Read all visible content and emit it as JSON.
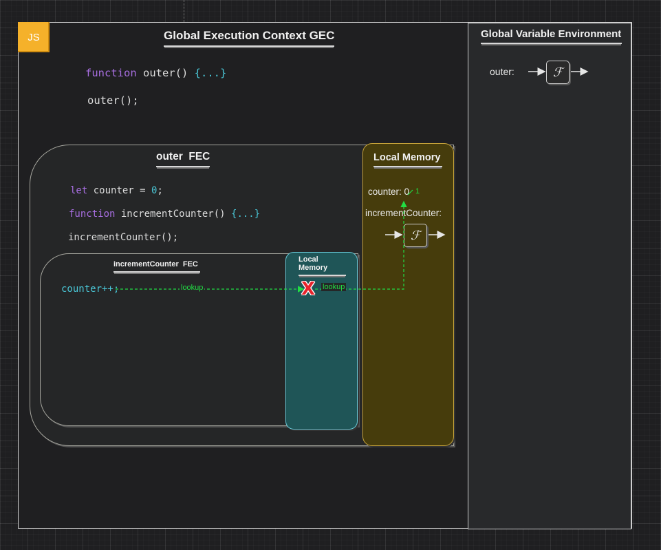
{
  "badge": "JS",
  "gec": {
    "title": "Global Execution Context GEC",
    "code_keyword": "function",
    "code_name": "outer()",
    "code_body": "{...}",
    "call": "outer();"
  },
  "gve": {
    "title": "Global Variable Environment",
    "outer_label": "outer:",
    "fn_glyph": "ℱ"
  },
  "outer_fec": {
    "title": "outer  FEC",
    "line1_kw": "let",
    "line1_rest": " counter = ",
    "line1_num": "0",
    "line1_end": ";",
    "line2_kw": "function",
    "line2_rest": " incrementCounter() ",
    "line2_body": "{...}",
    "line3": "incrementCounter();"
  },
  "outer_memory": {
    "title": "Local Memory",
    "counter_label": "counter: 0",
    "counter_new": "1",
    "inc_label": "incrementCounter:",
    "fn_glyph": "ℱ"
  },
  "inc_fec": {
    "title": "incrementCounter  FEC",
    "code": "counter++;"
  },
  "inc_memory": {
    "title": "Local Memory"
  },
  "lookup": {
    "label1": "lookup",
    "label2": "lookup",
    "miss": "X"
  },
  "colors": {
    "badge": "#f5b12a",
    "outer_memory_bg": "#463c0c",
    "outer_memory_border": "#c9a53a",
    "inc_memory_bg": "#1f5557",
    "inc_memory_border": "#67c8d6",
    "lookup": "#22dd44",
    "miss": "#e8242c"
  }
}
